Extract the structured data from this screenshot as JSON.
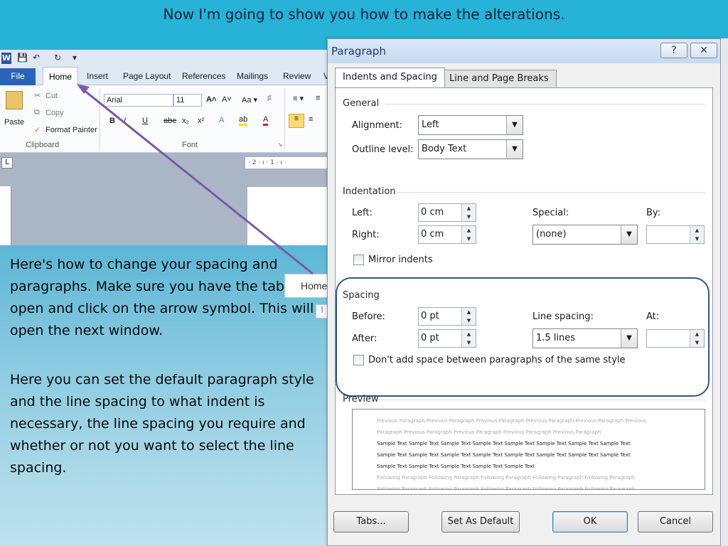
{
  "slide": {
    "title": "Now I'm going to show you how to make the alterations.",
    "paragraph1": "Here's how to change your spacing and paragraphs. Make sure you have the tab open and click on the arrow symbol. This will open the next window.",
    "paragraph2": "Here you can set the default paragraph style and the line spacing to what indent is necessary, the line spacing you require and whether or not you want to select the line spacing.",
    "home_zoom_label": "Home",
    "accent": "#27b2d8",
    "arrow_color": "#7a5aa8"
  },
  "word": {
    "qat_logo": "W",
    "qat_extra": "▾",
    "tabs": [
      "Insert",
      "Page Layout",
      "References",
      "Mailings",
      "Review",
      "V"
    ],
    "file_tab": "File",
    "home_tab": "Home",
    "clipboard": {
      "paste": "Paste",
      "cut": "Cut",
      "copy": "Copy",
      "format_painter": "Format Painter",
      "group_label": "Clipboard"
    },
    "font": {
      "name": "Arial",
      "size": "11",
      "group_label": "Font"
    },
    "ruler_marks": "· 2 · ı · 1 · ı ·",
    "ruler_corner": "L"
  },
  "dialog": {
    "title": "Paragraph",
    "help_btn": "?",
    "close_btn": "✕",
    "tabs": {
      "indents_spacing": "Indents and Spacing",
      "line_page_breaks": "Line and Page Breaks"
    },
    "general": {
      "heading": "General",
      "alignment_label": "Alignment:",
      "alignment_value": "Left",
      "outline_label": "Outline level:",
      "outline_value": "Body Text"
    },
    "indentation": {
      "heading": "Indentation",
      "left_label": "Left:",
      "left_value": "0 cm",
      "right_label": "Right:",
      "right_value": "0 cm",
      "special_label": "Special:",
      "special_value": "(none)",
      "by_label": "By:",
      "by_value": "",
      "mirror_label": "Mirror indents"
    },
    "spacing": {
      "heading": "Spacing",
      "before_label": "Before:",
      "before_value": "0 pt",
      "after_label": "After:",
      "after_value": "0 pt",
      "line_spacing_label": "Line spacing:",
      "line_spacing_value": "1.5 lines",
      "at_label": "At:",
      "at_value": "",
      "dont_add_label": "Don't add space between paragraphs of the same style"
    },
    "preview": {
      "heading": "Preview",
      "lines": [
        {
          "kind": "prev",
          "text": "Previous Paragraph Previous Paragraph Previous Paragraph Previous Paragraph Previous Paragraph Previous"
        },
        {
          "kind": "prev",
          "text": "Paragraph Previous Paragraph Previous Paragraph Previous Paragraph Previous Paragraph"
        },
        {
          "kind": "samp",
          "text": "Sample Text Sample Text Sample Text Sample Text Sample Text Sample Text Sample Text Sample Text"
        },
        {
          "kind": "samp",
          "text": "Sample Text Sample Text Sample Text Sample Text Sample Text Sample Text Sample Text Sample Text"
        },
        {
          "kind": "samp",
          "text": "Sample Text Sample Text Sample Text Sample Text Sample Text"
        },
        {
          "kind": "prev",
          "text": "Following Paragraph Following Paragraph Following Paragraph Following Paragraph Following Paragraph"
        },
        {
          "kind": "prev",
          "text": "Following Paragraph Following Paragraph Following Paragraph Following Paragraph Following Paragraph"
        }
      ]
    },
    "buttons": {
      "tabs": "Tabs...",
      "set_default": "Set As Default",
      "ok": "OK",
      "cancel": "Cancel"
    }
  }
}
